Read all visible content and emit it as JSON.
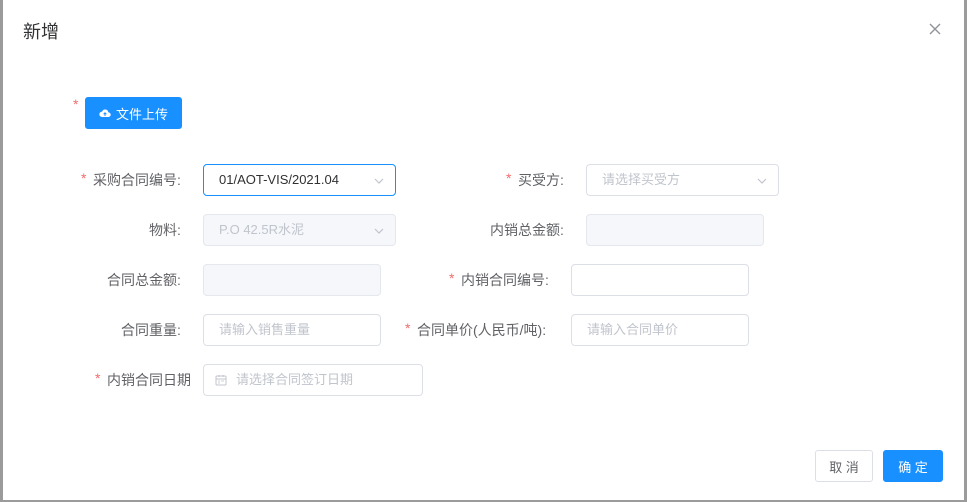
{
  "dialog": {
    "title": "新增"
  },
  "upload": {
    "label": "文件上传"
  },
  "form": {
    "purchase_contract_no": {
      "label": "采购合同编号:",
      "value": "01/AOT-VIS/2021.04"
    },
    "buyer_supplier": {
      "label": "买受方:",
      "placeholder": "请选择买受方"
    },
    "material": {
      "label": "物料:",
      "value": "P.O 42.5R水泥"
    },
    "domestic_total_amount": {
      "label": "内销总金额:",
      "value": ""
    },
    "contract_total_amount": {
      "label": "合同总金额:",
      "value": ""
    },
    "domestic_contract_no": {
      "label": "内销合同编号:",
      "value": ""
    },
    "contract_weight": {
      "label": "合同重量:",
      "placeholder": "请输入销售重量"
    },
    "contract_unit_price": {
      "label": "合同单价(人民币/吨):",
      "placeholder": "请输入合同单价"
    },
    "domestic_contract_date": {
      "label": "内销合同日期",
      "placeholder": "请选择合同签订日期"
    }
  },
  "footer": {
    "cancel": "取 消",
    "confirm": "确 定"
  },
  "colors": {
    "primary": "#1890ff",
    "required": "#f56c6c"
  }
}
